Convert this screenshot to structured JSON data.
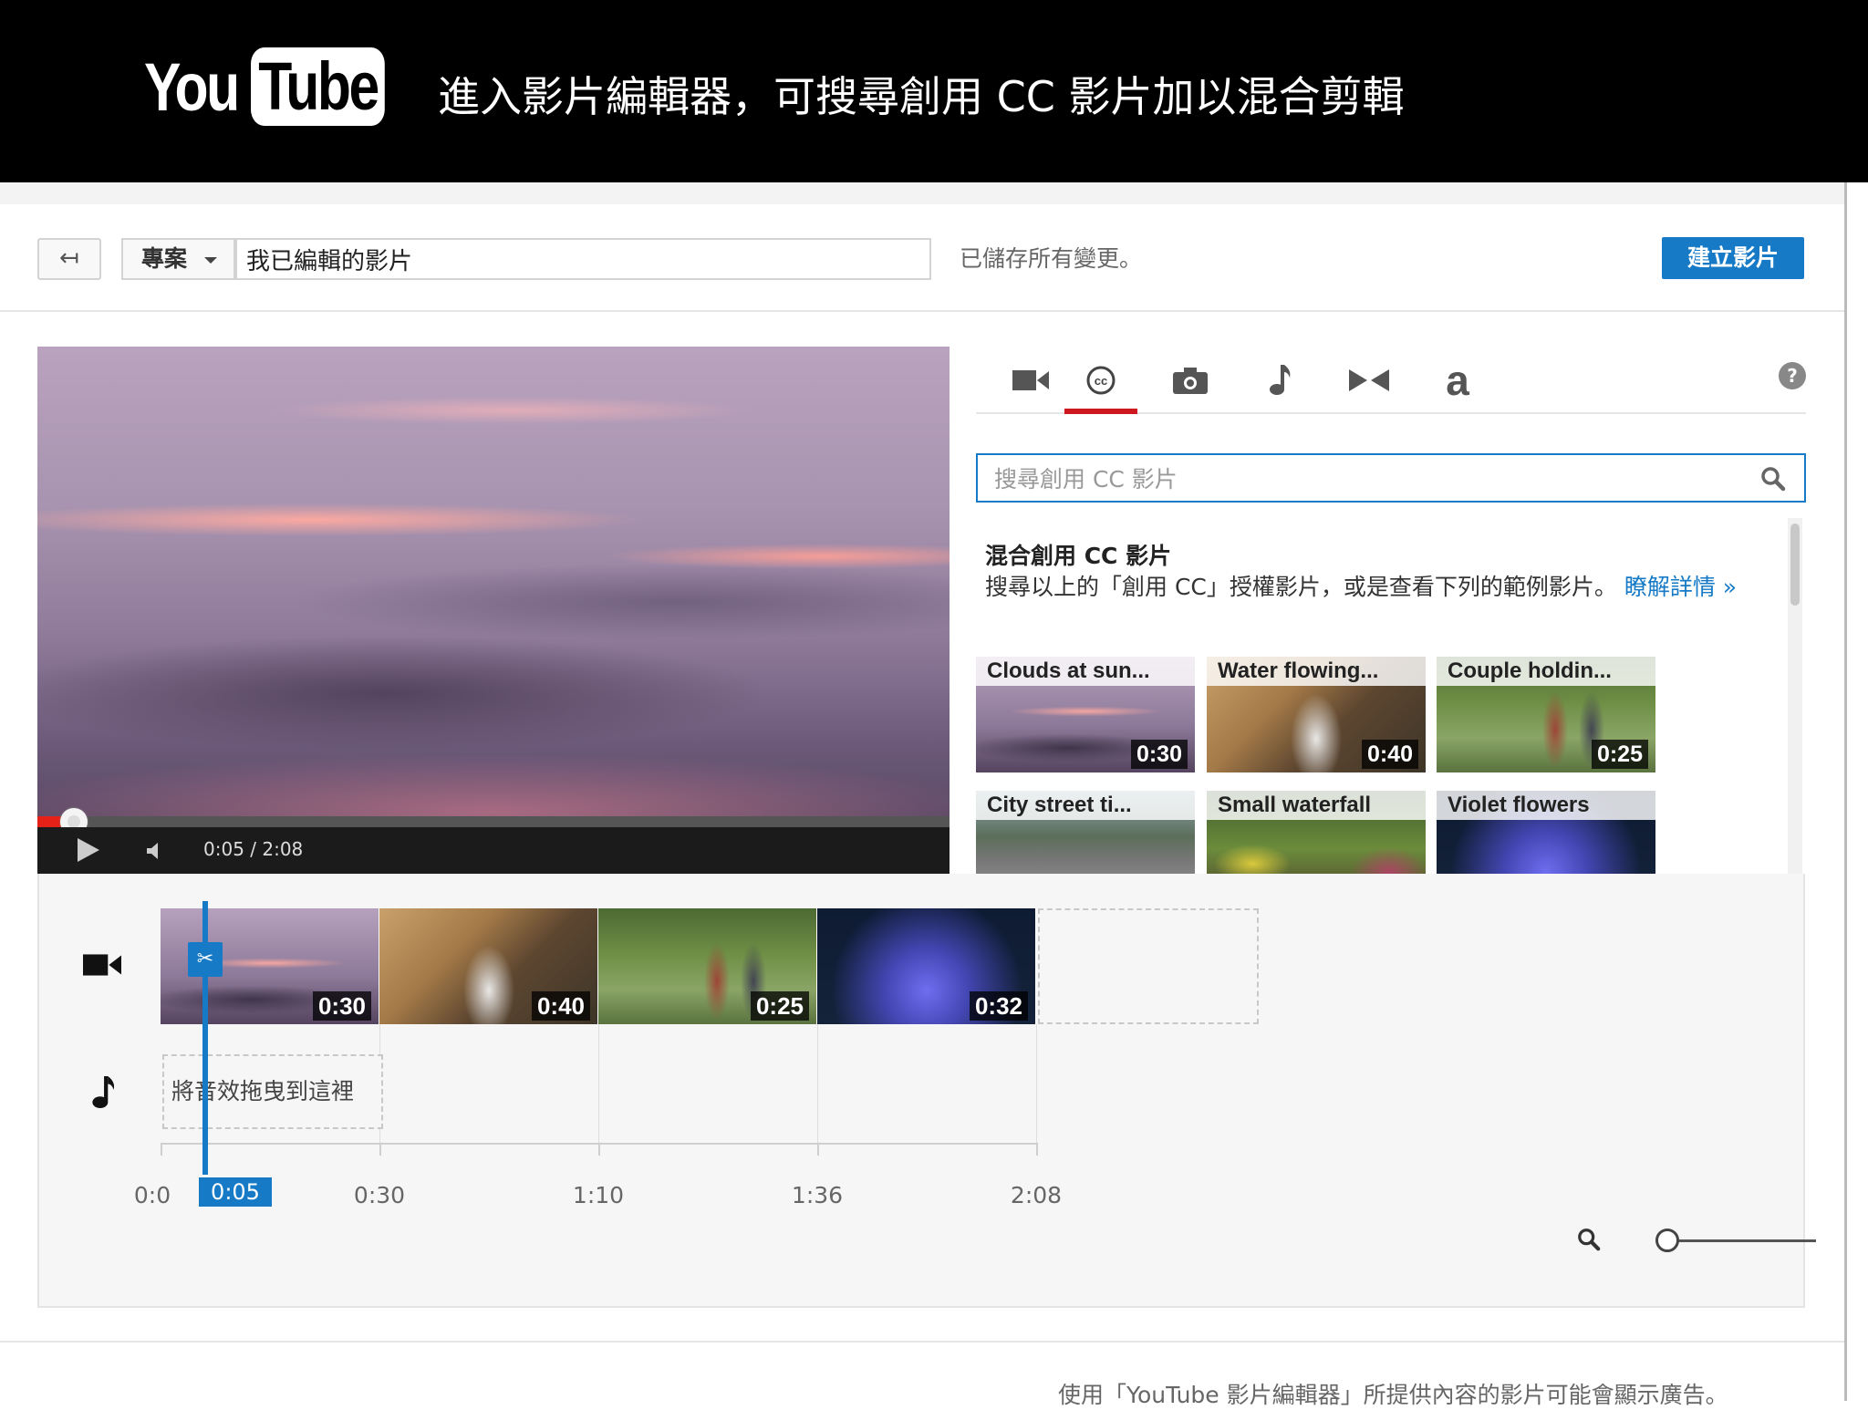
{
  "banner": {
    "logo_you": "You",
    "logo_tube": "Tube",
    "title": "進入影片編輯器，可搜尋創用 CC 影片加以混合剪輯"
  },
  "toolbar": {
    "back_label": "↤",
    "project_label": "專案",
    "title_value": "我已編輯的影片",
    "saved_status": "已儲存所有變更。",
    "create_label": "建立影片"
  },
  "player": {
    "current_time": "0:05",
    "duration": "2:08",
    "time_text": "0:05 / 2:08",
    "progress": 0.04
  },
  "tabs": [
    {
      "icon": "video-camera-icon",
      "active": false
    },
    {
      "icon": "creative-commons-icon",
      "active": true
    },
    {
      "icon": "photo-camera-icon",
      "active": false
    },
    {
      "icon": "music-note-icon",
      "active": false
    },
    {
      "icon": "transitions-icon",
      "active": false
    },
    {
      "icon": "text-icon",
      "glyph": "a",
      "active": false
    }
  ],
  "help_label": "?",
  "search": {
    "placeholder": "搜尋創用 CC 影片"
  },
  "cc_panel": {
    "heading": "混合創用 CC 影片",
    "description": "搜尋以上的「創用 CC」授權影片，或是查看下列的範例影片。",
    "learn_more": "瞭解詳情 »",
    "videos": [
      {
        "title": "Clouds at sun...",
        "duration": "0:30"
      },
      {
        "title": "Water flowing...",
        "duration": "0:40"
      },
      {
        "title": "Couple holdin...",
        "duration": "0:25"
      },
      {
        "title": "City street ti...",
        "duration": ""
      },
      {
        "title": "Small waterfall",
        "duration": ""
      },
      {
        "title": "Violet flowers",
        "duration": ""
      }
    ]
  },
  "timeline": {
    "clips": [
      {
        "duration": "0:30"
      },
      {
        "duration": "0:40"
      },
      {
        "duration": "0:25"
      },
      {
        "duration": "0:32"
      }
    ],
    "audio_drop_label": "將音效拖曳到這裡",
    "ruler_labels": [
      "0:0",
      "0:30",
      "1:10",
      "1:36",
      "2:08"
    ],
    "playhead_time": "0:05"
  },
  "footer_note": "使用「YouTube 影片編輯器」所提供內容的影片可能會顯示廣告。",
  "colors": {
    "accent_blue": "#167ac6",
    "active_tab_red": "#cc181e",
    "progress_red": "#e62117"
  }
}
